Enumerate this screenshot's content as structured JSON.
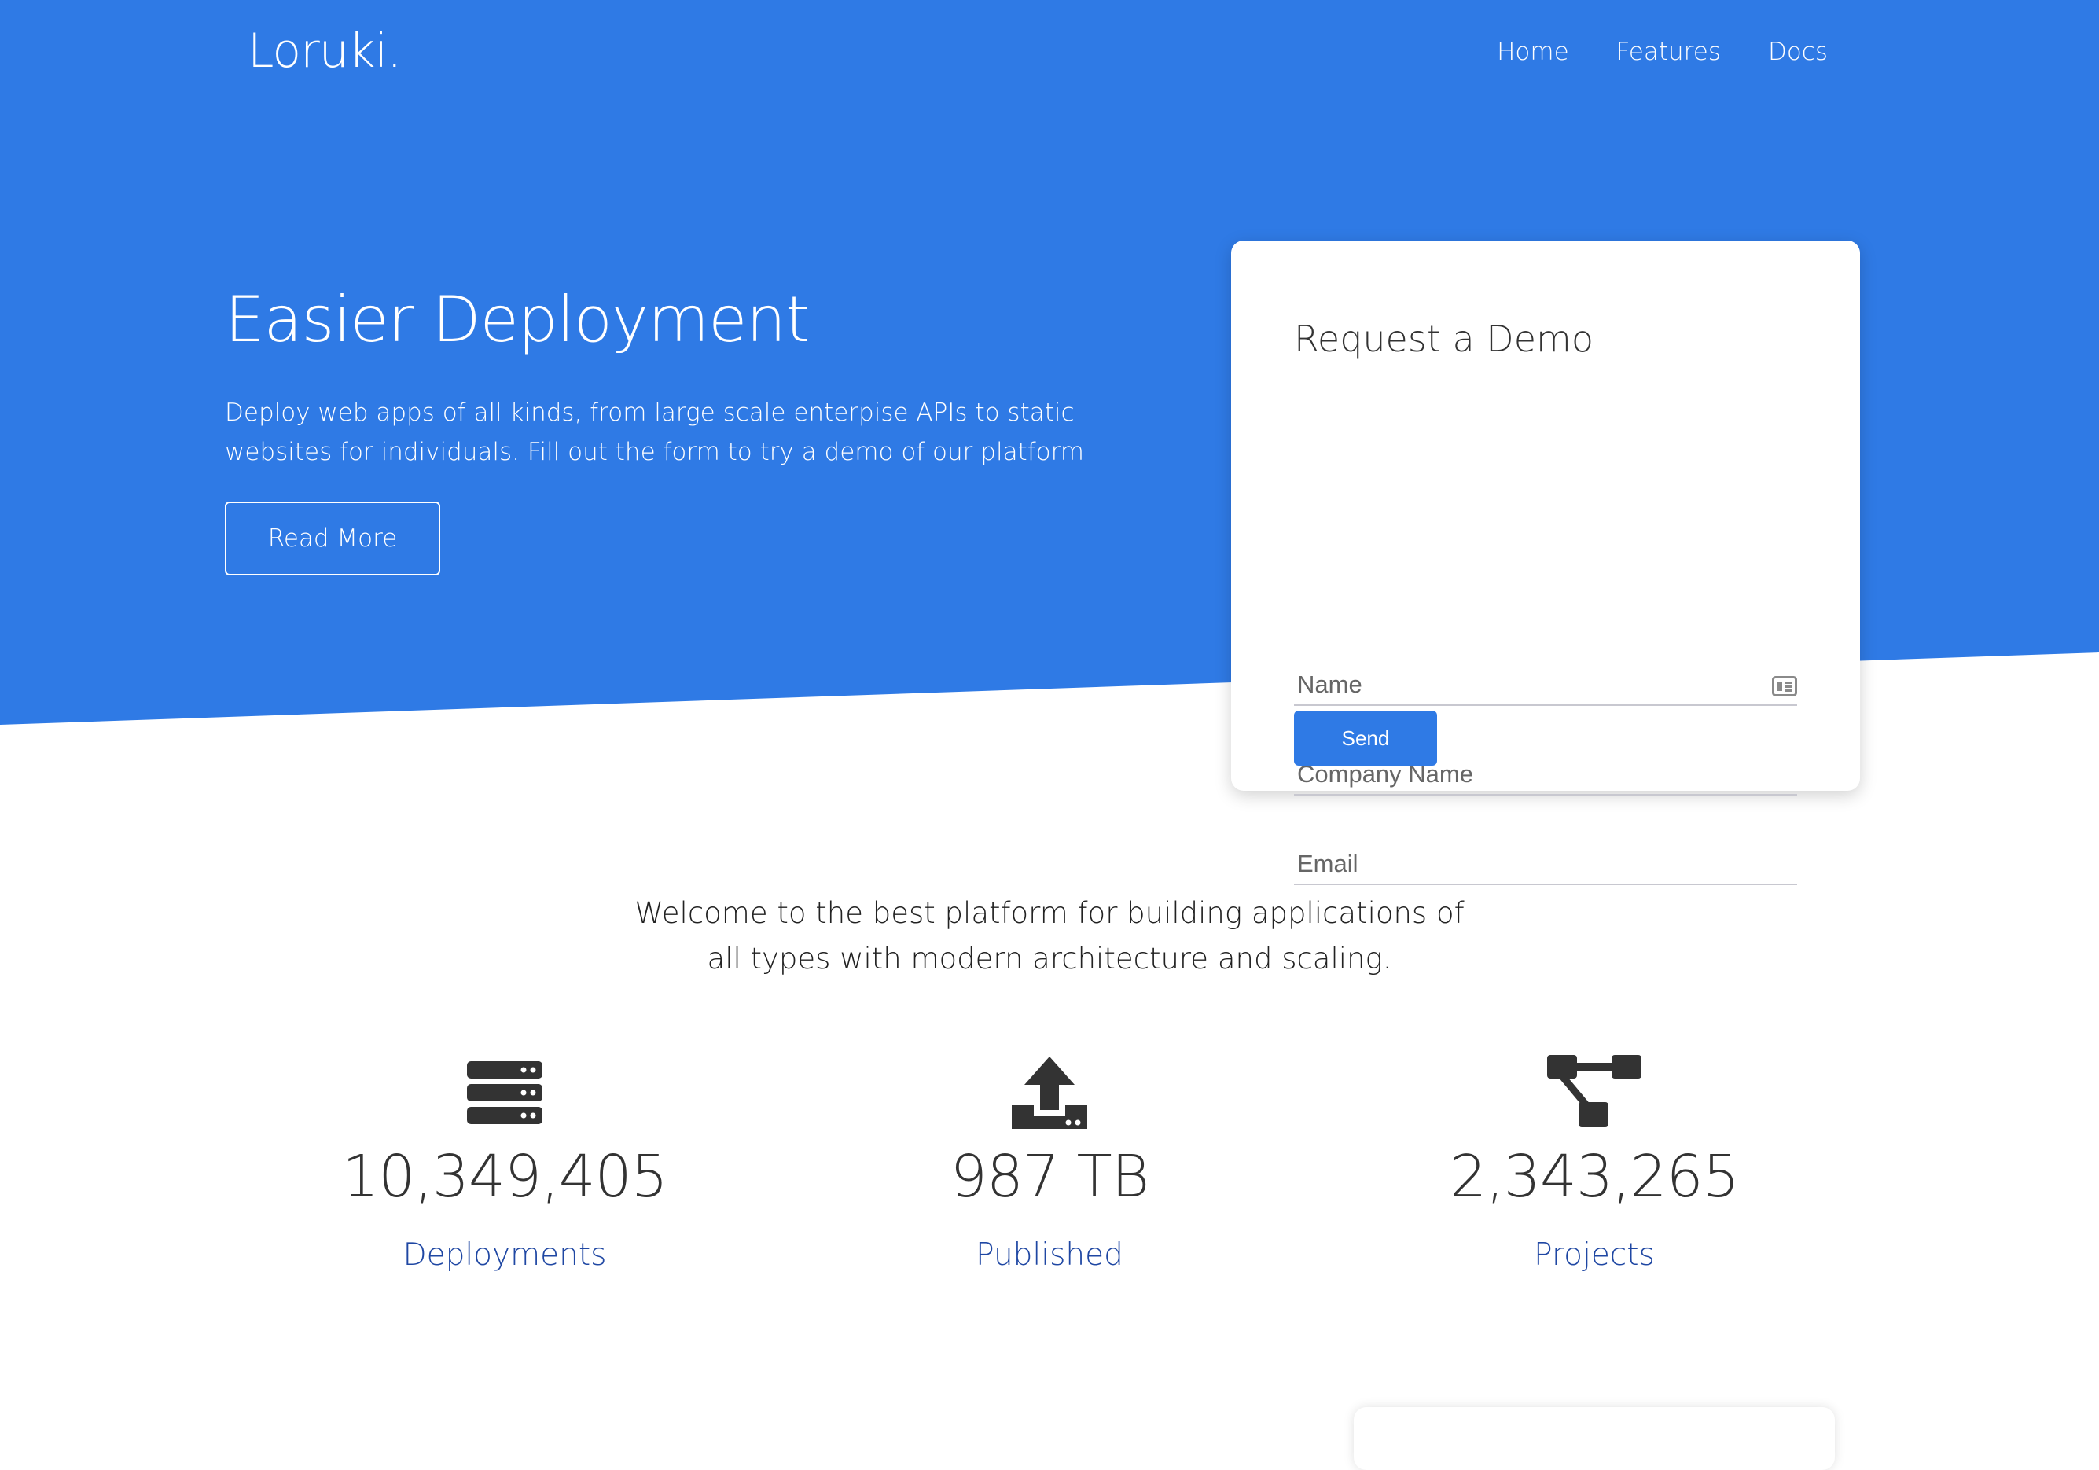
{
  "brand": {
    "logo": "Loruki.",
    "primary_color": "#2f7ae5"
  },
  "nav": {
    "items": [
      "Home",
      "Features",
      "Docs"
    ]
  },
  "hero": {
    "title": "Easier Deployment",
    "description": "Deploy web apps of all kinds, from large scale enterpise APIs to static websites for individuals. Fill out the form to try a demo of our platform",
    "read_more_label": "Read More"
  },
  "demo_form": {
    "title": "Request a Demo",
    "name_placeholder": "Name",
    "company_placeholder": "Company Name",
    "email_placeholder": "Email",
    "send_label": "Send"
  },
  "welcome": {
    "text": "Welcome to the best platform for building applications of all types with modern architecture and scaling."
  },
  "stats": [
    {
      "icon": "server-icon",
      "value": "10,349,405",
      "label": "Deployments"
    },
    {
      "icon": "upload-icon",
      "value": "987 TB",
      "label": "Published"
    },
    {
      "icon": "project-diagram-icon",
      "value": "2,343,265",
      "label": "Projects"
    }
  ]
}
